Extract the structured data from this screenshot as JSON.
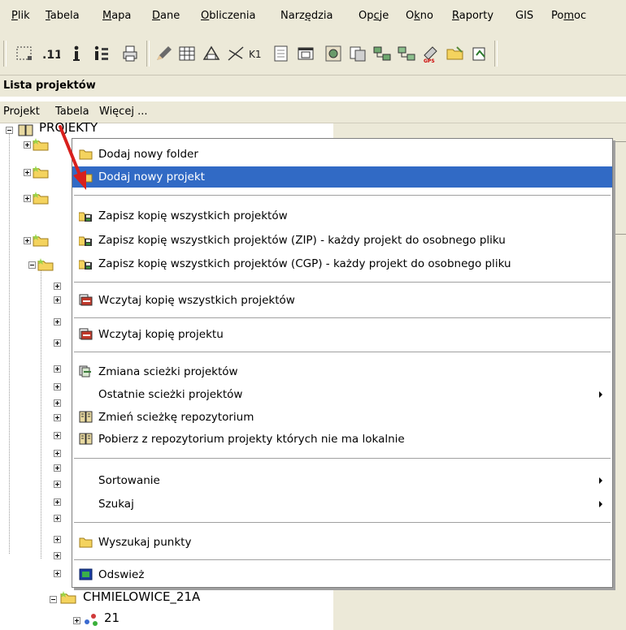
{
  "menubar": {
    "items": [
      {
        "pre": "",
        "u": "P",
        "post": "lik"
      },
      {
        "pre": "",
        "u": "T",
        "post": "abela"
      },
      {
        "pre": "",
        "u": "M",
        "post": "apa"
      },
      {
        "pre": "",
        "u": "D",
        "post": "ane"
      },
      {
        "pre": "",
        "u": "O",
        "post": "bliczenia"
      },
      {
        "pre": "Narz",
        "u": "ę",
        "post": "dzia"
      },
      {
        "pre": "Op",
        "u": "c",
        "post": "je"
      },
      {
        "pre": "O",
        "u": "k",
        "post": "no"
      },
      {
        "pre": "",
        "u": "R",
        "post": "aporty"
      },
      {
        "pre": "GIS",
        "u": "",
        "post": ""
      },
      {
        "pre": "Po",
        "u": "m",
        "post": "oc"
      }
    ]
  },
  "toolbar": {
    "k1_label": "K1",
    "count_label": ".11",
    "icons": [
      "select-rect-icon",
      "signal-icon",
      "info-icon",
      "info-list-icon",
      "print-icon",
      "pencil-icon",
      "table-icon",
      "triangle-icon",
      "cross-lines-icon",
      "k1-icon",
      "document-icon",
      "window-icon",
      "map-icon",
      "copy-icon",
      "network-icon",
      "network2-icon",
      "gps-icon",
      "folder-open-icon",
      "export-icon"
    ]
  },
  "panel": {
    "title": "Lista projektów",
    "menu": [
      "Projekt",
      "Tabela",
      "Więcej ..."
    ]
  },
  "tree": {
    "root_label": "PROJEKTY",
    "node_label": "CHMIELOWICE_21A",
    "child_label": "21"
  },
  "context_menu": {
    "items": [
      {
        "label": "Dodaj nowy folder",
        "icon": "folder-icon",
        "submenu": false,
        "selected": false
      },
      {
        "label": "Dodaj nowy projekt",
        "icon": "project-icon",
        "submenu": false,
        "selected": true
      },
      {
        "sep": true
      },
      {
        "label": "Zapisz kopię wszystkich projektów",
        "icon": "backup-icon",
        "submenu": false
      },
      {
        "label": "Zapisz kopię wszystkich projektów (ZIP) - każdy projekt do osobnego pliku",
        "icon": "backup-zip-icon",
        "submenu": false
      },
      {
        "label": "Zapisz kopię wszystkich projektów (CGP) - każdy projekt do osobnego pliku",
        "icon": "backup-cgp-icon",
        "submenu": false
      },
      {
        "sep": true
      },
      {
        "label": "Wczytaj kopię wszystkich projektów",
        "icon": "restore-all-icon",
        "submenu": false
      },
      {
        "sep": true
      },
      {
        "label": "Wczytaj kopię projektu",
        "icon": "restore-icon",
        "submenu": false
      },
      {
        "sep": true
      },
      {
        "label": "Zmiana scieżki projektów",
        "icon": "change-path-icon",
        "submenu": false
      },
      {
        "label": "Ostatnie scieżki projektów",
        "icon": "",
        "submenu": true
      },
      {
        "label": "Zmień scieżkę repozytorium",
        "icon": "repository-icon",
        "submenu": false
      },
      {
        "label": "Pobierz z repozytorium projekty których nie ma lokalnie",
        "icon": "repository-download-icon",
        "submenu": false
      },
      {
        "sep": true
      },
      {
        "label": "Sortowanie",
        "icon": "",
        "submenu": true
      },
      {
        "label": "Szukaj",
        "icon": "",
        "submenu": true
      },
      {
        "sep": true
      },
      {
        "label": "Wyszukaj punkty",
        "icon": "folder-search-icon",
        "submenu": false
      },
      {
        "sep": true
      },
      {
        "label": "Odswież",
        "icon": "refresh-icon",
        "submenu": false
      }
    ]
  },
  "colors": {
    "selection": "#316ac5",
    "chrome": "#ece9d8",
    "arrow": "#d8201c"
  }
}
